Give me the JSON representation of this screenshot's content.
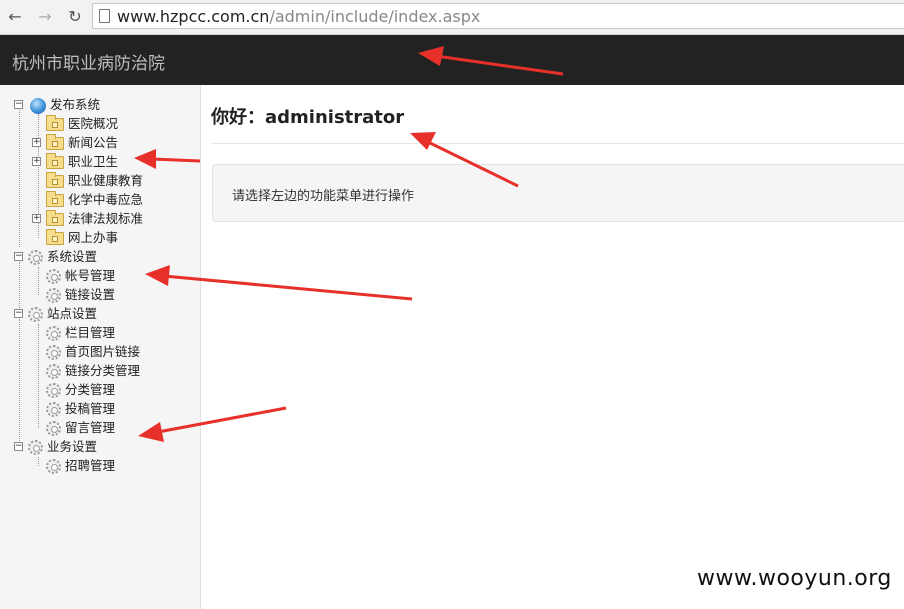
{
  "browser": {
    "url_host": "www.hzpcc.com.cn",
    "url_path": "/admin/include/index.aspx"
  },
  "header": {
    "title": "杭州市职业病防治院"
  },
  "sidebar": {
    "items": [
      {
        "label": "发布系统"
      },
      {
        "label": "医院概况"
      },
      {
        "label": "新闻公告"
      },
      {
        "label": "职业卫生"
      },
      {
        "label": "职业健康教育"
      },
      {
        "label": "化学中毒应急"
      },
      {
        "label": "法律法规标准"
      },
      {
        "label": "网上办事"
      },
      {
        "label": "系统设置"
      },
      {
        "label": "帐号管理"
      },
      {
        "label": "链接设置"
      },
      {
        "label": "站点设置"
      },
      {
        "label": "栏目管理"
      },
      {
        "label": "首页图片链接"
      },
      {
        "label": "链接分类管理"
      },
      {
        "label": "分类管理"
      },
      {
        "label": "投稿管理"
      },
      {
        "label": "留言管理"
      },
      {
        "label": "业务设置"
      },
      {
        "label": "招聘管理"
      }
    ]
  },
  "main": {
    "greeting": "你好：administrator",
    "message": "请选择左边的功能菜单进行操作"
  },
  "watermark": "www.wooyun.org",
  "colors": {
    "header_bg": "#222222",
    "arrow": "#e8302a"
  }
}
